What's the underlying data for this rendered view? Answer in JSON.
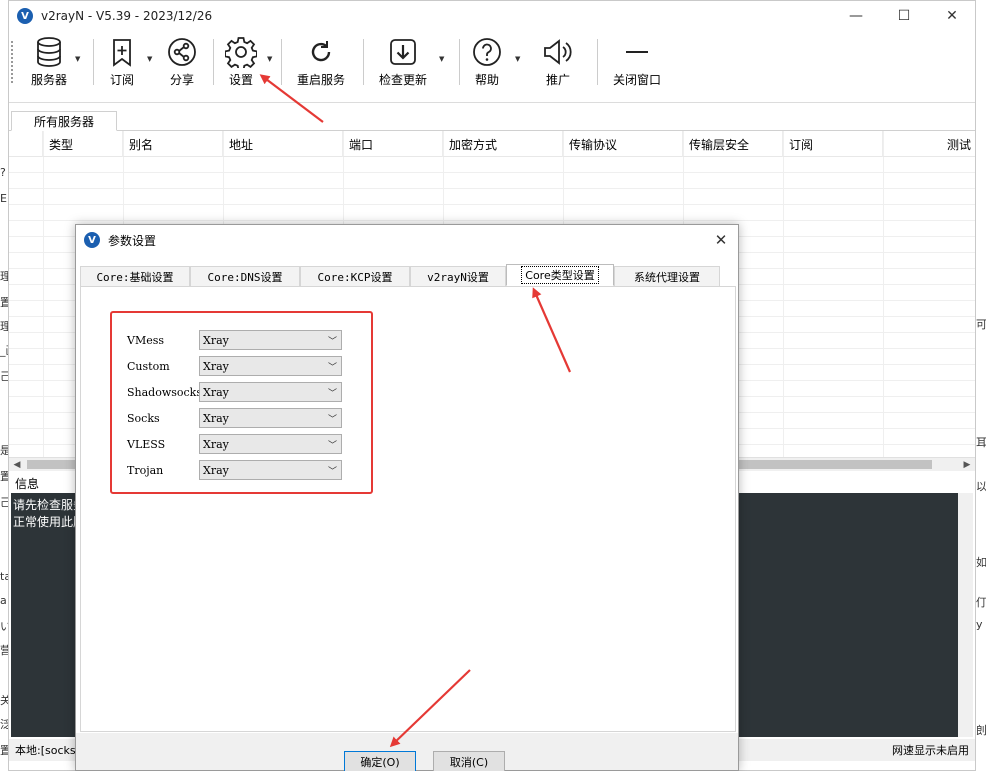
{
  "window": {
    "title": "v2rayN - V5.39 - 2023/12/26",
    "logo_letter": "V",
    "minimize": "—",
    "maximize": "☐",
    "close": "✕"
  },
  "toolbar": {
    "servers": "服务器",
    "subscription": "订阅",
    "share": "分享",
    "settings": "设置",
    "restart": "重启服务",
    "check_update": "检查更新",
    "help": "帮助",
    "promote": "推广",
    "close_window": "关闭窗口"
  },
  "tabs": {
    "all_servers": "所有服务器"
  },
  "grid": {
    "columns": [
      "类型",
      "别名",
      "地址",
      "端口",
      "加密方式",
      "传输协议",
      "传输层安全",
      "订阅",
      "测试"
    ]
  },
  "info": {
    "label": "信息",
    "log_lines": [
      "请先检查服务",
      "正常使用此服"
    ]
  },
  "status": {
    "left": "本地:[socks",
    "right": "网速显示未启用"
  },
  "dialog": {
    "title": "参数设置",
    "logo_letter": "V",
    "close": "✕",
    "tabs": [
      "Core:基础设置",
      "Core:DNS设置",
      "Core:KCP设置",
      "v2rayN设置",
      "Core类型设置",
      "系统代理设置"
    ],
    "core_types": [
      {
        "protocol": "VMess",
        "core": "Xray"
      },
      {
        "protocol": "Custom",
        "core": "Xray"
      },
      {
        "protocol": "Shadowsocks",
        "core": "Xray"
      },
      {
        "protocol": "Socks",
        "core": "Xray"
      },
      {
        "protocol": "VLESS",
        "core": "Xray"
      },
      {
        "protocol": "Trojan",
        "core": "Xray"
      }
    ],
    "ok": "确定(O)",
    "cancel": "取消(C)"
  },
  "background": {
    "left_fragments": [
      "?",
      "E(",
      "理",
      "置",
      "理",
      "_画",
      "己",
      "是_",
      "置",
      "己",
      "ta",
      "a",
      "い",
      "营",
      "关",
      "泛",
      "置"
    ],
    "right_fragments": [
      "耳",
      "以",
      "如",
      "仃",
      "y",
      "剆",
      "可"
    ]
  },
  "colors": {
    "annotation_red": "#e53935",
    "log_background": "#2d3438",
    "logo_blue": "#1b5fb0"
  }
}
